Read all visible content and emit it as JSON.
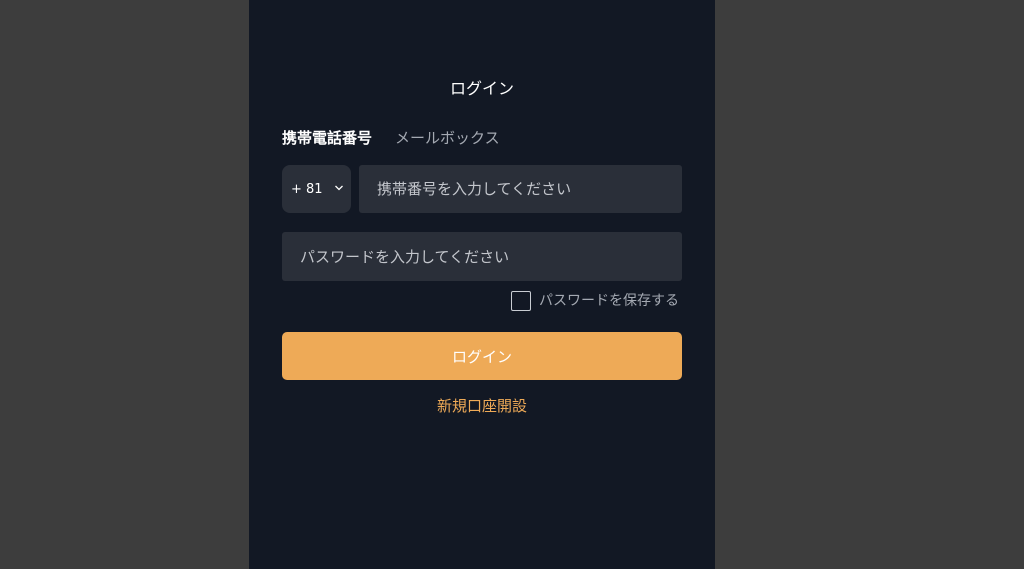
{
  "page": {
    "title": "ログイン"
  },
  "tabs": [
    {
      "label": "携帯電話番号",
      "active": true
    },
    {
      "label": "メールボックス",
      "active": false
    }
  ],
  "country_code": {
    "value": "+ 81",
    "icon": "chevron-down-icon"
  },
  "phone": {
    "placeholder": "携帯番号を入力してください",
    "value": ""
  },
  "password": {
    "placeholder": "パスワードを入力してください",
    "value": ""
  },
  "remember": {
    "label": "パスワードを保存する",
    "checked": false
  },
  "login_button": {
    "label": "ログイン"
  },
  "register_link": {
    "label": "新規口座開設"
  },
  "colors": {
    "background": "#3d3d3d",
    "panel": "#121824",
    "input": "#2a2f39",
    "accent": "#eeaa57"
  }
}
